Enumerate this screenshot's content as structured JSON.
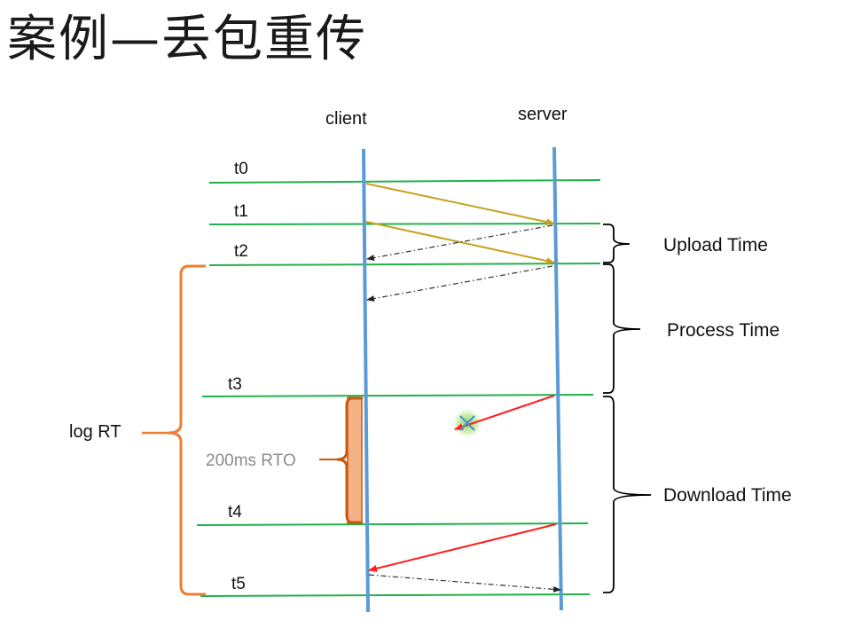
{
  "title": "案例—丢包重传",
  "columns": {
    "client": "client",
    "server": "server"
  },
  "time_marks": [
    "t0",
    "t1",
    "t2",
    "t3",
    "t4",
    "t5"
  ],
  "phases": {
    "upload": "Upload Time",
    "process": "Process Time",
    "download": "Download Time"
  },
  "log_rt": "log RT",
  "rto": "200ms RTO",
  "colors": {
    "lifeline": "#5b9bd5",
    "timeline": "#22b14c",
    "data_arrow": "#c8a11c",
    "response_arrow": "#ff2020",
    "ack_arrow": "#444444",
    "brace_orange": "#ed7d31",
    "rto_fill": "#f4b183",
    "brace_black": "#000000"
  }
}
